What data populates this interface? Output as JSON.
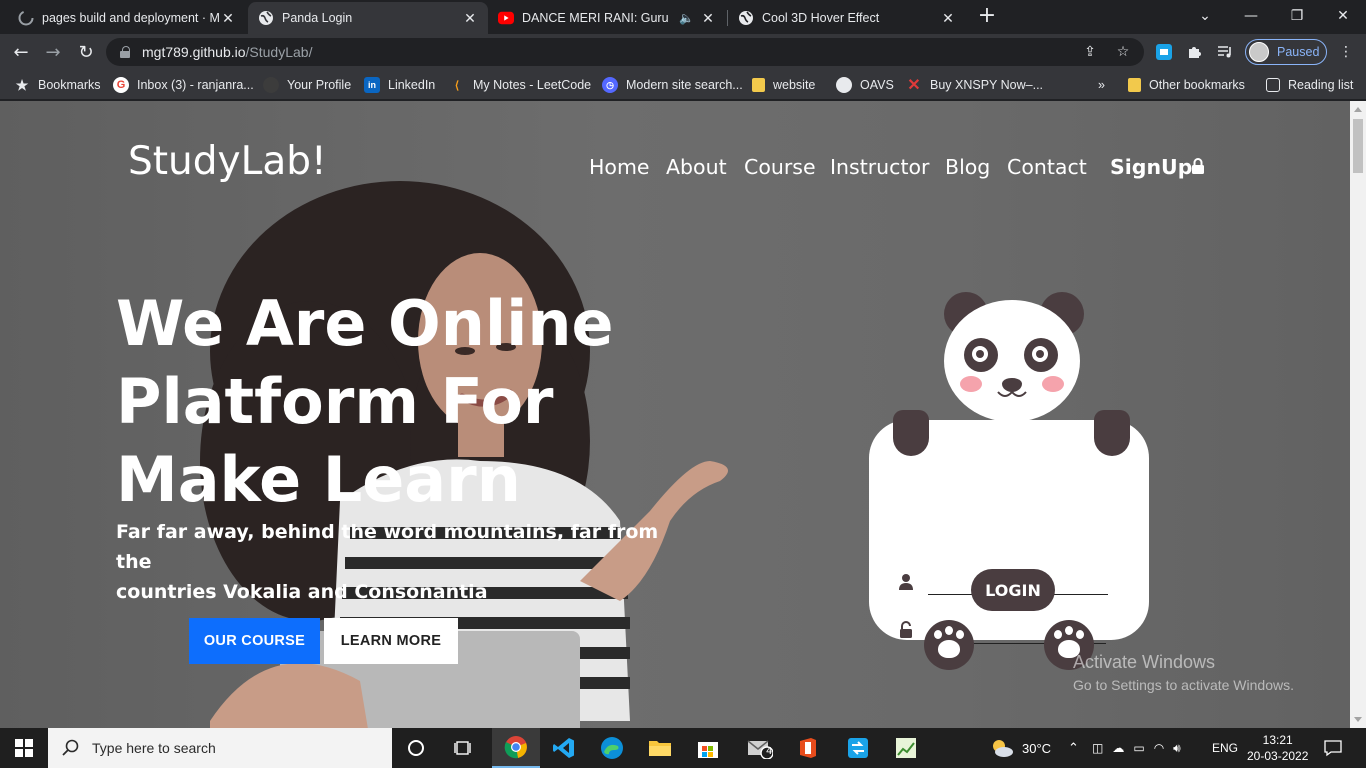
{
  "browser": {
    "tabs": [
      {
        "title": "pages build and deployment · M",
        "icon": "github-icon",
        "active": false
      },
      {
        "title": "Panda Login",
        "icon": "globe-icon",
        "active": true
      },
      {
        "title": "DANCE MERI RANI: Guru Ra",
        "icon": "youtube-icon",
        "active": false,
        "audio": true
      },
      {
        "title": "Cool 3D Hover Effect",
        "icon": "globe-icon",
        "active": false
      }
    ],
    "url_host": "mgt789.github.io",
    "url_path": "/StudyLab/",
    "profile_label": "Paused",
    "bookmarks": [
      {
        "label": "Bookmarks",
        "icon": "star-icon"
      },
      {
        "label": "Inbox (3) - ranjanra...",
        "icon": "google-icon"
      },
      {
        "label": "Your Profile",
        "icon": "github-icon"
      },
      {
        "label": "LinkedIn",
        "icon": "linkedin-icon"
      },
      {
        "label": "My Notes - LeetCode",
        "icon": "leetcode-icon"
      },
      {
        "label": "Modern site search...",
        "icon": "algolia-icon"
      },
      {
        "label": "website",
        "icon": "folder-icon"
      },
      {
        "label": "OAVS",
        "icon": "globe-icon"
      },
      {
        "label": "Buy XNSPY Now–...",
        "icon": "x-icon"
      }
    ],
    "bookmarks_overflow": "»",
    "other_bookmarks": "Other bookmarks",
    "reading_list": "Reading list"
  },
  "site": {
    "brand": "StudyLab!",
    "nav": [
      "Home",
      "About",
      "Course",
      "Instructor",
      "Blog",
      "Contact"
    ],
    "signup": "SignUp",
    "hero_title": [
      "We Are Online",
      "Platform For",
      "Make Learn"
    ],
    "hero_subtitle": [
      "Far far away, behind the word mountains, far from the",
      "countries Vokalia and Consonantia"
    ],
    "btn_course": "OUR COURSE",
    "btn_learn": "LEARN MORE",
    "login": {
      "username_value": "",
      "password_value": "",
      "button": "LOGIN"
    },
    "colors": {
      "panda_dark": "#4a3d40",
      "primary_blue": "#0d6efd",
      "blush": "#f5a3ac"
    }
  },
  "watermark": {
    "line1": "Activate Windows",
    "line2": "Go to Settings to activate Windows."
  },
  "taskbar": {
    "search_placeholder": "Type here to search",
    "weather": "30°C",
    "language": "ENG",
    "time": "13:21",
    "date": "20-03-2022",
    "mail_badge": "4"
  }
}
